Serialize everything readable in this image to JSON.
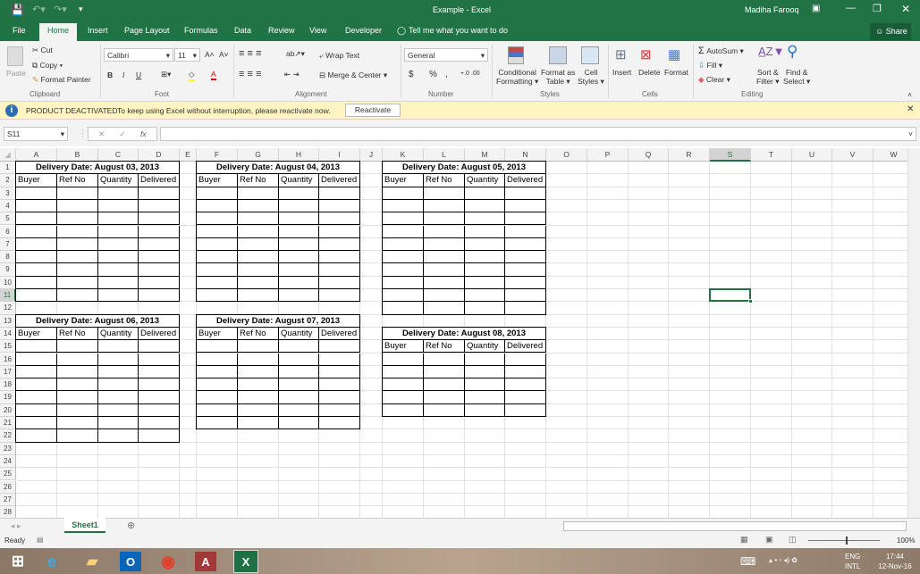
{
  "window": {
    "title": "Example - Excel",
    "user": "Madiha Farooq",
    "share": "Share"
  },
  "tabs": [
    "File",
    "Home",
    "Insert",
    "Page Layout",
    "Formulas",
    "Data",
    "Review",
    "View",
    "Developer"
  ],
  "tell_me": "Tell me what you want to do",
  "ribbon": {
    "clipboard": {
      "paste": "Paste",
      "cut": "Cut",
      "copy": "Copy",
      "format_painter": "Format Painter",
      "label": "Clipboard"
    },
    "font": {
      "name": "Calibri",
      "size": "11",
      "bold": "B",
      "italic": "I",
      "underline": "U",
      "label": "Font"
    },
    "alignment": {
      "wrap": "Wrap Text",
      "merge": "Merge & Center",
      "label": "Alignment"
    },
    "number": {
      "format": "General",
      "currency": "$",
      "percent": "%",
      "comma": ",",
      "label": "Number"
    },
    "styles": {
      "conditional": "Conditional",
      "conditional2": "Formatting",
      "format_table": "Format as",
      "format_table2": "Table",
      "cell_styles": "Cell",
      "cell_styles2": "Styles",
      "label": "Styles"
    },
    "cells": {
      "insert": "Insert",
      "delete": "Delete",
      "format": "Format",
      "label": "Cells"
    },
    "editing": {
      "autosum": "AutoSum",
      "fill": "Fill",
      "clear": "Clear",
      "sort": "Sort &",
      "sort2": "Filter",
      "find": "Find &",
      "find2": "Select",
      "label": "Editing"
    }
  },
  "message": {
    "title": "PRODUCT DEACTIVATED",
    "text": "To keep using Excel without interruption, please reactivate now.",
    "button": "Reactivate"
  },
  "formula_bar": {
    "name_box": "S11",
    "value": "",
    "fx": "fx"
  },
  "columns": [
    "A",
    "B",
    "C",
    "D",
    "E",
    "F",
    "G",
    "H",
    "I",
    "J",
    "K",
    "L",
    "M",
    "N",
    "O",
    "P",
    "Q",
    "R",
    "S",
    "T",
    "U",
    "V",
    "W"
  ],
  "row_count": 28,
  "selected_cell": {
    "col": "S",
    "row": 11
  },
  "tables": [
    {
      "title": "Delivery Date: August 03, 2013",
      "col": "A",
      "row": 1,
      "last_row": 11,
      "headers": [
        "Buyer",
        "Ref No",
        "Quantity",
        "Delivered"
      ]
    },
    {
      "title": "Delivery Date: August 04, 2013",
      "col": "F",
      "row": 1,
      "last_row": 11,
      "headers": [
        "Buyer",
        "Ref No",
        "Quantity",
        "Delivered"
      ]
    },
    {
      "title": "Delivery Date: August 05, 2013",
      "col": "K",
      "row": 1,
      "last_row": 12,
      "headers": [
        "Buyer",
        "Ref No",
        "Quantity",
        "Delivered"
      ]
    },
    {
      "title": "Delivery Date: August 06, 2013",
      "col": "A",
      "row": 13,
      "last_row": 22,
      "headers": [
        "Buyer",
        "Ref No",
        "Quantity",
        "Delivered"
      ]
    },
    {
      "title": "Delivery Date: August 07, 2013",
      "col": "F",
      "row": 13,
      "last_row": 21,
      "headers": [
        "Buyer",
        "Ref No",
        "Quantity",
        "Delivered"
      ]
    },
    {
      "title": "Delivery Date: August 08, 2013",
      "col": "K",
      "row": 14,
      "last_row": 20,
      "headers": [
        "Buyer",
        "Ref No",
        "Quantity",
        "Delivered"
      ]
    }
  ],
  "sheets": [
    "Sheet1"
  ],
  "status": {
    "ready": "Ready",
    "zoom": "100%"
  },
  "taskbar": {
    "lang": "ENG",
    "lang2": "INTL",
    "time": "17:44",
    "date": "12-Nov-16"
  },
  "colors": {
    "excel_green": "#217346",
    "selection": "#217346"
  }
}
